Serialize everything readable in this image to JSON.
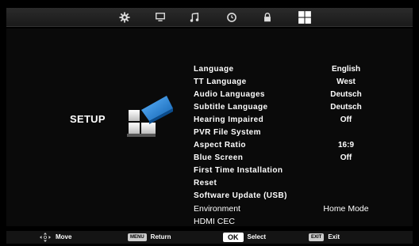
{
  "top_icons": [
    {
      "icon": "gear-icon"
    },
    {
      "icon": "monitor-icon"
    },
    {
      "icon": "music-note-icon"
    },
    {
      "icon": "clock-icon"
    },
    {
      "icon": "lock-icon"
    },
    {
      "icon": "setup-grid-icon"
    }
  ],
  "page_title": "SETUP",
  "menu": [
    {
      "label": "Language",
      "value": "English"
    },
    {
      "label": "TT Language",
      "value": "West"
    },
    {
      "label": "Audio Languages",
      "value": "Deutsch"
    },
    {
      "label": "Subtitle Language",
      "value": "Deutsch"
    },
    {
      "label": "Hearing Impaired",
      "value": "Off"
    },
    {
      "label": "PVR File System",
      "value": ""
    },
    {
      "label": "Aspect Ratio",
      "value": "16:9"
    },
    {
      "label": "Blue Screen",
      "value": "Off"
    },
    {
      "label": "First Time Installation",
      "value": ""
    },
    {
      "label": "Reset",
      "value": ""
    },
    {
      "label": "Software Update (USB)",
      "value": ""
    },
    {
      "label": "Environment",
      "value": "Home Mode"
    },
    {
      "label": "HDMI CEC",
      "value": ""
    }
  ],
  "footer": {
    "move_label": "Move",
    "menu_key": "MENU",
    "return_label": "Return",
    "ok_key": "OK",
    "select_label": "Select",
    "exit_key": "EXIT",
    "exit_label": "Exit"
  },
  "colors": {
    "accent_blue": "#1e7fd0",
    "background": "#000000",
    "text": "#ffffff"
  }
}
